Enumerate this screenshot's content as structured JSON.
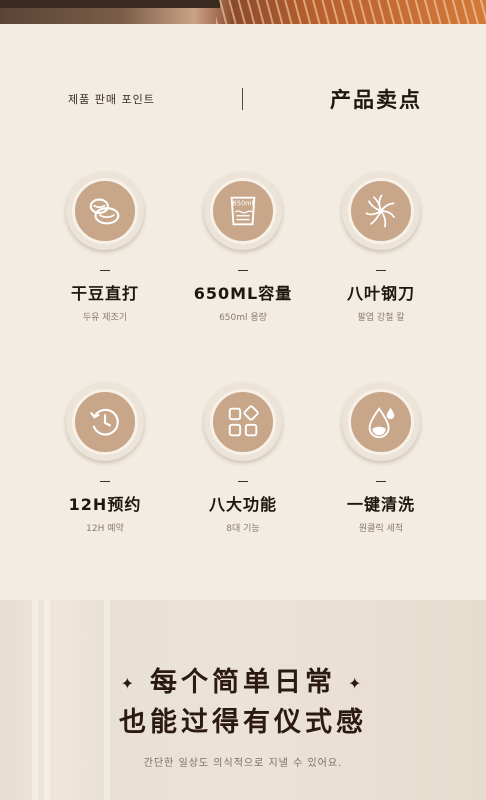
{
  "header": {
    "korean_title": "제품 판매 포인트",
    "chinese_title": "产品卖点"
  },
  "features": [
    {
      "icon": "beans-icon",
      "title": "干豆直打",
      "subtitle": "두유 제조기"
    },
    {
      "icon": "measuring-cup-icon",
      "title": "650ML容量",
      "subtitle": "650ml 용량",
      "icon_text": "650ml"
    },
    {
      "icon": "eight-blade-icon",
      "title": "八叶钢刀",
      "subtitle": "팔엽 강철 칼"
    },
    {
      "icon": "clock-timer-icon",
      "title": "12H预约",
      "subtitle": "12H 예약"
    },
    {
      "icon": "grid-functions-icon",
      "title": "八大功能",
      "subtitle": "8대 기능"
    },
    {
      "icon": "water-drop-icon",
      "title": "一键清洗",
      "subtitle": "원클릭 세척"
    }
  ],
  "tagline": {
    "line1": "每个简单日常",
    "line2": "也能过得有仪式感",
    "korean": "간단한 일상도 의식적으로 지낼 수 있어요.",
    "sparkle": "✦"
  },
  "colors": {
    "background": "#f2ece2",
    "icon_fill": "#c7a68a",
    "text_dark": "#1f1610"
  }
}
